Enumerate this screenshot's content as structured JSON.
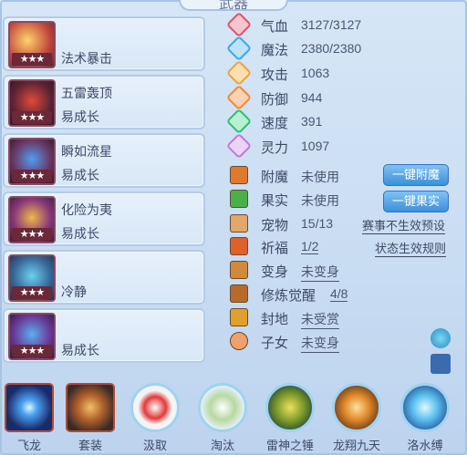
{
  "title": "武器",
  "left_list": [
    {
      "stars": "★★★",
      "line1": "",
      "line2": "法术暴击"
    },
    {
      "stars": "★★★",
      "line1": "五雷轰顶",
      "line2": "易成长"
    },
    {
      "stars": "★★★",
      "line1": "瞬如流星",
      "line2": "易成长"
    },
    {
      "stars": "★★★",
      "line1": "化险为夷",
      "line2": "易成长"
    },
    {
      "stars": "★★★",
      "line1": "",
      "line2": "冷静"
    },
    {
      "stars": "★★★",
      "line1": "",
      "line2": "易成长"
    }
  ],
  "stats": [
    {
      "label": "气血",
      "value": "3127/3127",
      "icon": "heart-icon",
      "color": "#e2506a"
    },
    {
      "label": "魔法",
      "value": "2380/2380",
      "icon": "mana-icon",
      "color": "#3aa8f0"
    },
    {
      "label": "攻击",
      "value": "1063",
      "icon": "attack-icon",
      "color": "#f0a23a"
    },
    {
      "label": "防御",
      "value": "944",
      "icon": "defense-icon",
      "color": "#f08a3a"
    },
    {
      "label": "速度",
      "value": "391",
      "icon": "speed-icon",
      "color": "#2fbf74"
    },
    {
      "label": "灵力",
      "value": "1097",
      "icon": "spirit-icon",
      "color": "#c07ad8"
    }
  ],
  "attrs": {
    "fumo": {
      "label": "附魔",
      "value": "未使用"
    },
    "guoshi": {
      "label": "果实",
      "value": "未使用"
    },
    "chongwu": {
      "label": "宠物",
      "value": "15/13"
    },
    "qifu": {
      "label": "祈福",
      "value": "1/2"
    },
    "bianshen": {
      "label": "变身",
      "value": "未变身"
    },
    "xiulian": {
      "label": "修炼觉醒",
      "value": "4/8"
    },
    "fengdi": {
      "label": "封地",
      "value": "未受赏"
    },
    "zinv": {
      "label": "子女",
      "value": "未变身"
    }
  },
  "buttons": {
    "fumo": "一键附魔",
    "guoshi": "一键果实"
  },
  "links": {
    "saishi": "赛事不生效预设",
    "zhuangtai": "状态生效规则"
  },
  "bottom_skills": [
    {
      "label": "飞龙"
    },
    {
      "label": "套装"
    },
    {
      "label": "汲取"
    },
    {
      "label": "淘汰"
    },
    {
      "label": "雷神之锤"
    },
    {
      "label": "龙翔九天"
    },
    {
      "label": "洛水缚"
    }
  ]
}
